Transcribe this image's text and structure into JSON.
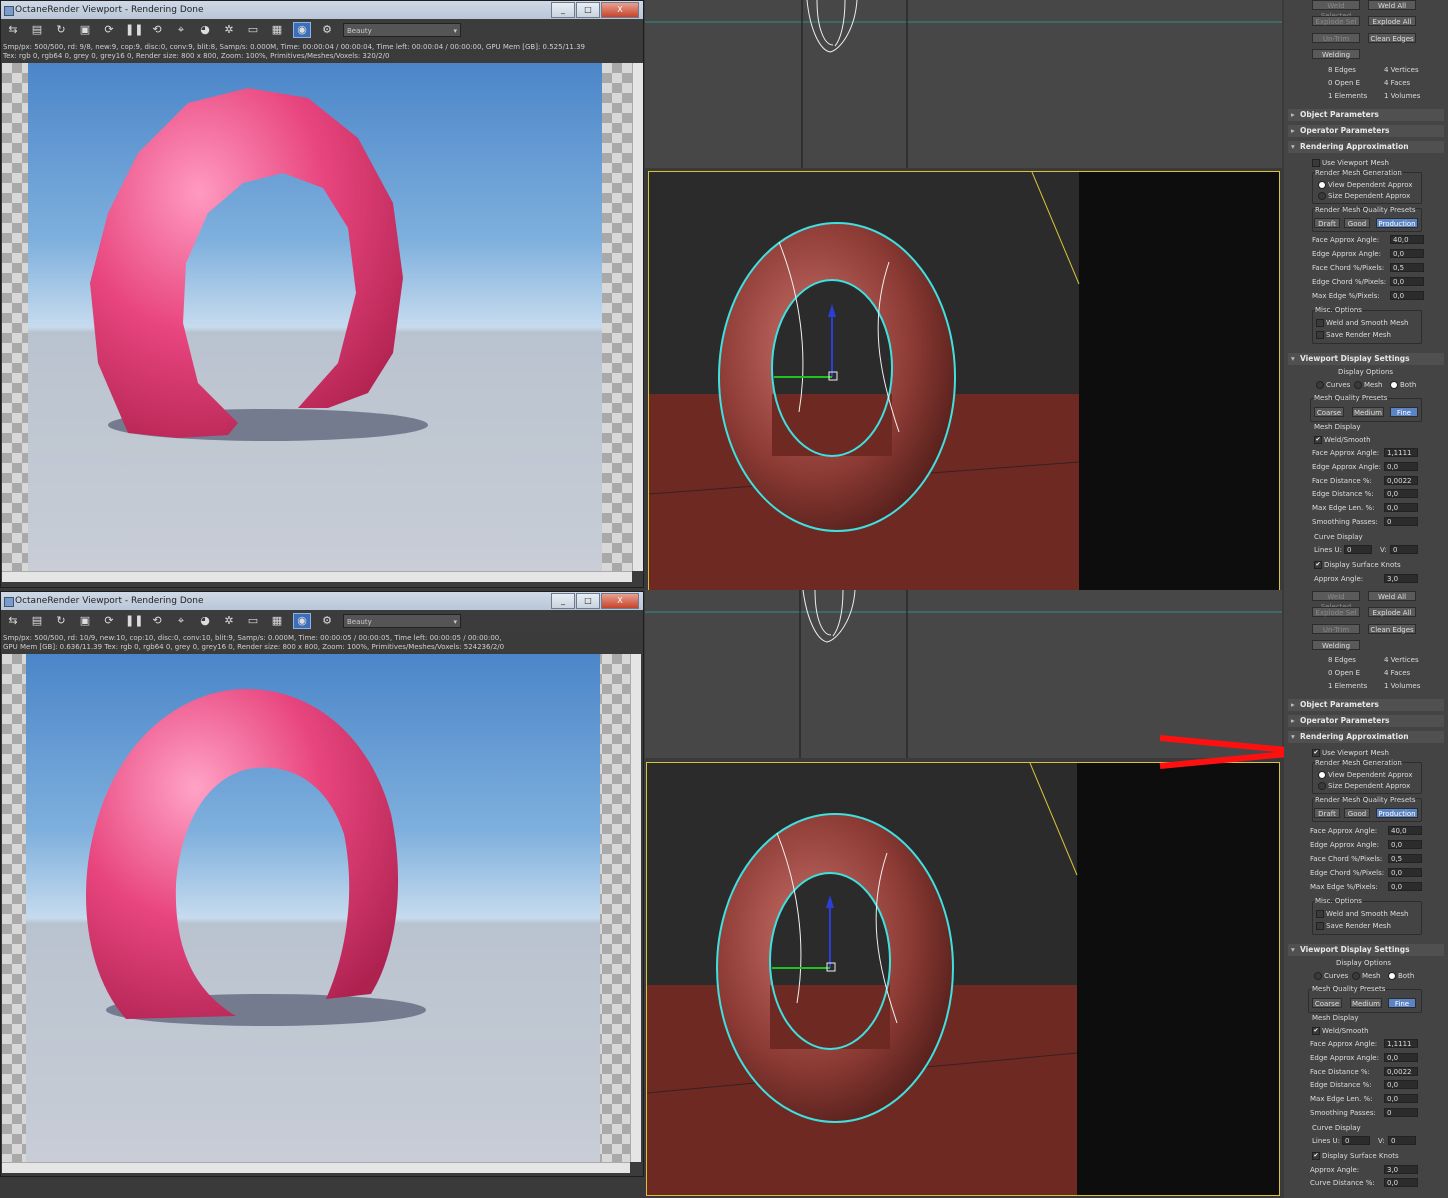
{
  "octane": {
    "title": "OctaneRender Viewport - Rendering Done",
    "buttons": {
      "minimize": "_",
      "maximize": "□",
      "close": "X"
    },
    "toolbar_select": "Beauty",
    "window1": {
      "stat1": "Smp/px: 500/500,   rd: 9/8,   new:9, cop:9, disc:0, conv:9, blit:8,   Samp/s: 0.000M,   Time: 00:00:04 / 00:00:04,   Time left: 00:00:04 / 00:00:00,   GPU Mem [GB]: 0.525/11.39",
      "stat2": "Tex: rgb 0, rgb64 0, grey 0, grey16 0,   Render size: 800 x 800,   Zoom: 100%,   Primitives/Meshes/Voxels: 320/2/0"
    },
    "window2": {
      "stat1": "Smp/px: 500/500,   rd: 10/9,   new:10, cop:10, disc:0, conv:10, blit:9,   Samp/s: 0.000M,   Time: 00:00:05 / 00:00:05,   Time left: 00:00:05 / 00:00:00,",
      "stat2": "GPU Mem [GB]: 0.636/11.39   Tex: rgb 0, rgb64 0, grey 0, grey16 0,   Render size: 800 x 800,   Zoom: 100%,   Primitives/Meshes/Voxels: 524236/2/0"
    }
  },
  "panels": [
    {
      "top_buttons": {
        "weld_selected": "Weld Selected",
        "weld_all": "Weld All",
        "explode_sel": "Explode Sel",
        "explode_all": "Explode All",
        "un_trim": "Un-Trim",
        "clean_edges": "Clean Edges",
        "welding": "Welding"
      },
      "stats": {
        "edges": "8 Edges",
        "vertices": "4 Vertices",
        "open_e": "0 Open E",
        "faces": "4 Faces",
        "elements": "1 Elements",
        "volumes": "1 Volumes"
      },
      "rollouts": {
        "object": "Object Parameters",
        "operator": "Operator Parameters",
        "rendering": "Rendering Approximation"
      },
      "use_viewport_mesh": "Use Viewport Mesh",
      "render_mesh_gen": "Render Mesh Generation",
      "view_dependent": "View Dependent Approx",
      "size_dependent": "Size Dependent Approx",
      "quality_presets": "Render Mesh Quality Presets",
      "presets": {
        "draft": "Draft",
        "good": "Good",
        "production": "Production"
      },
      "params": [
        {
          "label": "Face Approx Angle:",
          "value": "40,0"
        },
        {
          "label": "Edge Approx Angle:",
          "value": "0,0"
        },
        {
          "label": "Face Chord %/Pixels:",
          "value": "0,5"
        },
        {
          "label": "Edge Chord %/Pixels:",
          "value": "0,0"
        },
        {
          "label": "Max Edge %/Pixels:",
          "value": "0,0"
        }
      ],
      "misc": "Misc. Options",
      "weld_smooth_mesh": "Weld and Smooth Mesh",
      "save_render_mesh": "Save Render Mesh",
      "viewport_settings": "Viewport Display Settings",
      "display_options": "Display Options",
      "curves": "Curves",
      "mesh": "Mesh",
      "both": "Both",
      "mesh_quality_presets": "Mesh Quality Presets",
      "mq": {
        "coarse": "Coarse",
        "medium": "Medium",
        "fine": "Fine"
      },
      "mesh_display": "Mesh Display",
      "weld_smooth": "Weld/Smooth",
      "mparams": [
        {
          "label": "Face Approx Angle:",
          "value": "1,1111"
        },
        {
          "label": "Edge Approx Angle:",
          "value": "0,0"
        },
        {
          "label": "Face Distance %:",
          "value": "0,0022"
        },
        {
          "label": "Edge Distance %:",
          "value": "0,0"
        },
        {
          "label": "Max Edge Len. %:",
          "value": "0,0"
        },
        {
          "label": "Smoothing Passes:",
          "value": "0"
        }
      ],
      "curve_display": "Curve Display",
      "lines_u": "Lines U:",
      "lines_u_val": "0",
      "lines_v": "V:",
      "lines_v_val": "0",
      "display_surface_knots": "Display Surface Knots",
      "approx_angle": "Approx Angle:",
      "approx_angle_val": "3,0",
      "curve_distance": "",
      "curve_distance_val": ""
    },
    {
      "top_buttons": {
        "weld_selected": "Weld Selected",
        "weld_all": "Weld All",
        "explode_sel": "Explode Sel",
        "explode_all": "Explode All",
        "un_trim": "Un-Trim",
        "clean_edges": "Clean Edges",
        "welding": "Welding"
      },
      "stats": {
        "edges": "8 Edges",
        "vertices": "4 Vertices",
        "open_e": "0 Open E",
        "faces": "4 Faces",
        "elements": "1 Elements",
        "volumes": "1 Volumes"
      },
      "rollouts": {
        "object": "Object Parameters",
        "operator": "Operator Parameters",
        "rendering": "Rendering Approximation"
      },
      "use_viewport_mesh": "Use Viewport Mesh",
      "render_mesh_gen": "Render Mesh Generation",
      "view_dependent": "View Dependent Approx",
      "size_dependent": "Size Dependent Approx",
      "quality_presets": "Render Mesh Quality Presets",
      "presets": {
        "draft": "Draft",
        "good": "Good",
        "production": "Production"
      },
      "params": [
        {
          "label": "Face Approx Angle:",
          "value": "40,0"
        },
        {
          "label": "Edge Approx Angle:",
          "value": "0,0"
        },
        {
          "label": "Face Chord %/Pixels:",
          "value": "0,5"
        },
        {
          "label": "Edge Chord %/Pixels:",
          "value": "0,0"
        },
        {
          "label": "Max Edge %/Pixels:",
          "value": "0,0"
        }
      ],
      "misc": "Misc. Options",
      "weld_smooth_mesh": "Weld and Smooth Mesh",
      "save_render_mesh": "Save Render Mesh",
      "viewport_settings": "Viewport Display Settings",
      "display_options": "Display Options",
      "curves": "Curves",
      "mesh": "Mesh",
      "both": "Both",
      "mesh_quality_presets": "Mesh Quality Presets",
      "mq": {
        "coarse": "Coarse",
        "medium": "Medium",
        "fine": "Fine"
      },
      "mesh_display": "Mesh Display",
      "weld_smooth": "Weld/Smooth",
      "mparams": [
        {
          "label": "Face Approx Angle:",
          "value": "1,1111"
        },
        {
          "label": "Edge Approx Angle:",
          "value": "0,0"
        },
        {
          "label": "Face Distance %:",
          "value": "0,0022"
        },
        {
          "label": "Edge Distance %:",
          "value": "0,0"
        },
        {
          "label": "Max Edge Len. %:",
          "value": "0,0"
        },
        {
          "label": "Smoothing Passes:",
          "value": "0"
        }
      ],
      "curve_display": "Curve Display",
      "lines_u": "Lines U:",
      "lines_u_val": "0",
      "lines_v": "V:",
      "lines_v_val": "0",
      "display_surface_knots": "Display Surface Knots",
      "approx_angle": "Approx Angle:",
      "approx_angle_val": "3,0",
      "curve_distance": "Curve Distance %:",
      "curve_distance_val": "0,0"
    }
  ],
  "colors": {
    "selection": "#3fe0e0",
    "annotation_arrow": "#ff1010",
    "pink": "#e8457e"
  }
}
